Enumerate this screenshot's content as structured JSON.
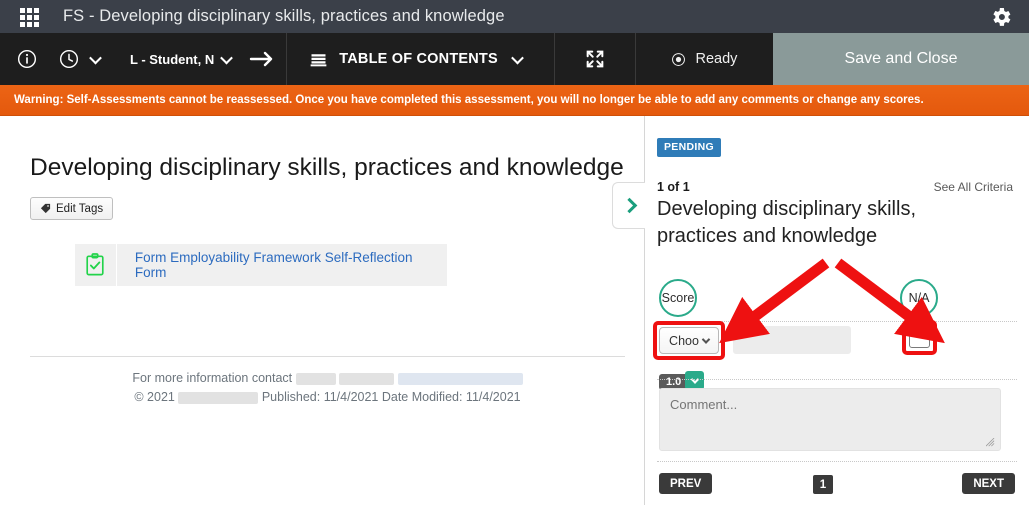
{
  "topbar": {
    "app_launcher_icon": "grid-apps-icon",
    "title": "FS - Developing disciplinary skills, practices and knowledge",
    "settings_icon": "gear-icon",
    "background": "#3b4049"
  },
  "toolbar": {
    "info_icon": "info-circle-icon",
    "history_icon": "clock-icon",
    "history_caret": "chevron-down-icon",
    "user_label": "L - Student, N",
    "user_caret": "chevron-down-icon",
    "forward_icon": "arrow-right-icon",
    "toc_icon": "stacked-layers-icon",
    "toc_label": "TABLE OF CONTENTS",
    "toc_caret": "chevron-down-icon",
    "fullscreen_icon": "expand-fullscreen-icon",
    "status_icon": "radio-dot-icon",
    "status_label": "Ready",
    "save_close_label": "Save and Close",
    "save_close_bg": "#8a9a99",
    "background": "#1e1e1e"
  },
  "warning": {
    "text": "Warning: Self-Assessments cannot be reassessed. Once you have completed this assessment, you will no longer be able to add any comments or change any scores.",
    "background": "#e95d10"
  },
  "left": {
    "page_title": "Developing disciplinary skills, practices and knowledge",
    "edit_tags_icon": "tag-icon",
    "edit_tags_label": "Edit Tags",
    "form_icon": "clipboard-check-icon",
    "form_link_label": "Form Employability Framework Self-Reflection Form",
    "footer_contact_prefix": "For more information contact",
    "footer_copyright": "© 2021",
    "footer_published": "Published: 11/4/2021 Date Modified: 11/4/2021",
    "expander_icon": "chevron-right-icon"
  },
  "right": {
    "status_badge": "PENDING",
    "status_badge_color": "#2f7cb8",
    "criteria_count": "1 of 1",
    "see_all_label": "See All Criteria",
    "criteria_title": "Developing disciplinary skills, practices and knowledge",
    "score_value": "1.0",
    "score_caret_icon": "chevron-down-icon",
    "score_circle_label": "Score",
    "na_circle_label": "N/A",
    "accent_green": "#2aaa8a",
    "choose_label": "Choo",
    "choose_caret_icon": "chevron-down-icon",
    "score_input_value": "",
    "na_checkbox_icon": "checkbox-unchecked-icon",
    "comment_placeholder": "Comment...",
    "comment_value": "",
    "prev_label": "PREV",
    "page_number": "1",
    "next_label": "NEXT"
  },
  "annotations": {
    "highlight_color": "#ee1111",
    "arrow_1_target": "choose-dropdown",
    "arrow_2_target": "na-checkbox"
  }
}
